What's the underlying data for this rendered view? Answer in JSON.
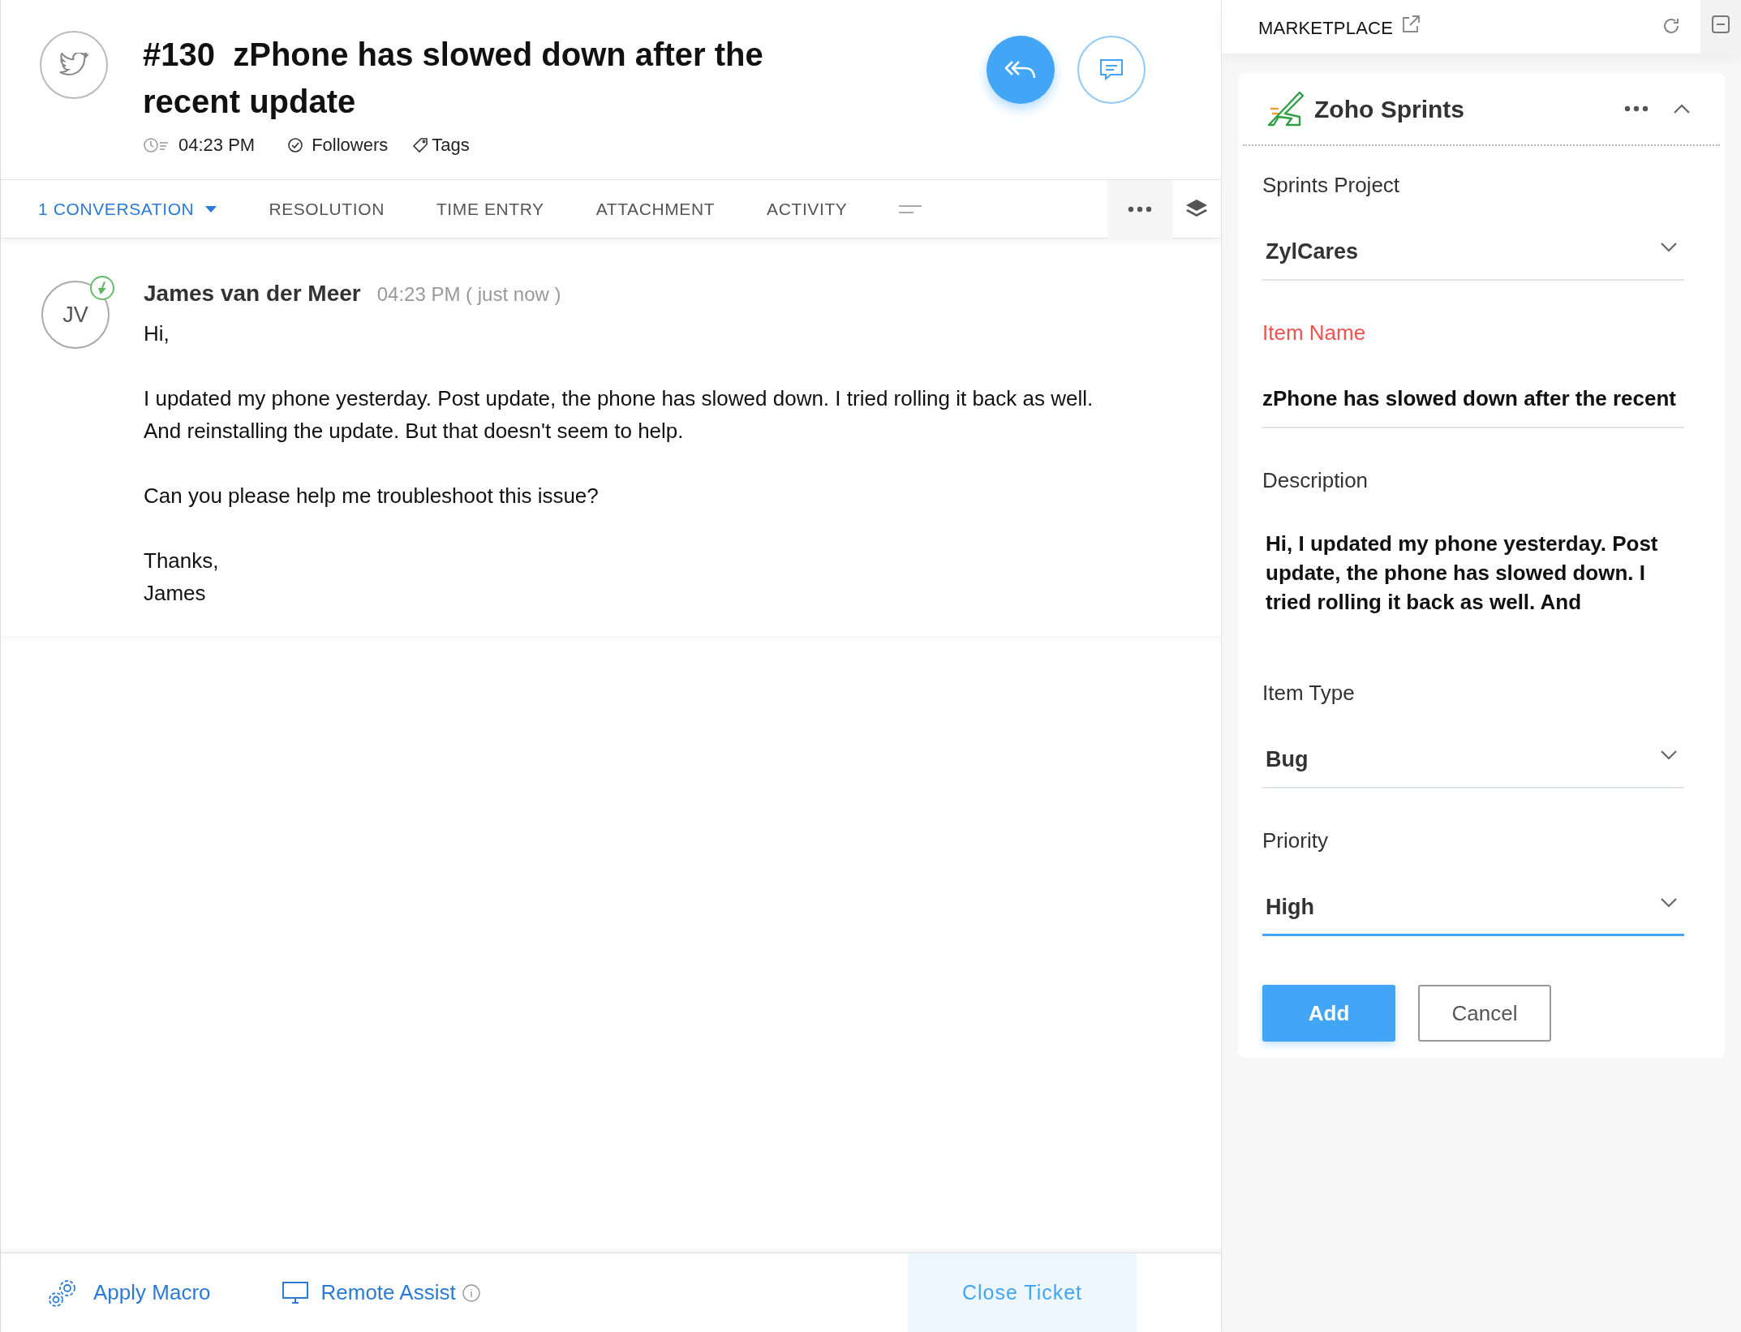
{
  "ticket": {
    "number": "#130",
    "title": "zPhone has slowed down after the recent update",
    "time": "04:23 PM",
    "followers": "Followers",
    "tags": "Tags"
  },
  "tabs": [
    {
      "label": "1 CONVERSATION",
      "selected": true,
      "dropdown": true
    },
    {
      "label": "RESOLUTION",
      "selected": false,
      "dropdown": false
    },
    {
      "label": "TIME ENTRY",
      "selected": false,
      "dropdown": false
    },
    {
      "label": "ATTACHMENT",
      "selected": false,
      "dropdown": false
    },
    {
      "label": "ACTIVITY",
      "selected": false,
      "dropdown": false
    }
  ],
  "message": {
    "initials": "JV",
    "author": "James van der Meer",
    "time": "04:23 PM ( just now )",
    "paragraphs": [
      "Hi,",
      "I updated my phone yesterday. Post update, the phone has slowed down. I tried rolling it back as well. And reinstalling the update. But that doesn't seem to help.",
      "Can you please help me troubleshoot this issue?",
      "Thanks,\nJames"
    ]
  },
  "footer": {
    "apply_macro": "Apply Macro",
    "remote_assist": "Remote Assist",
    "close_ticket": "Close Ticket"
  },
  "marketplace": {
    "title": "MARKETPLACE",
    "app": {
      "name": "Zoho Sprints",
      "expanded": true,
      "fields": [
        {
          "kind": "select",
          "label": "Sprints Project",
          "value": "ZylCares",
          "required": false,
          "focused": false
        },
        {
          "kind": "text",
          "label": "Item Name",
          "value": "zPhone has slowed down after the recent",
          "required": true,
          "focused": false
        },
        {
          "kind": "textarea",
          "label": "Description",
          "value": "Hi, I updated my phone yesterday. Post update, the phone has slowed down. I tried rolling it back as well. And",
          "required": false
        },
        {
          "kind": "select",
          "label": "Item Type",
          "value": "Bug",
          "required": false,
          "focused": false
        },
        {
          "kind": "select",
          "label": "Priority",
          "value": "High",
          "required": false,
          "focused": true
        }
      ],
      "buttons": [
        {
          "label": "Add",
          "primary": true
        },
        {
          "label": "Cancel",
          "primary": false
        }
      ]
    }
  }
}
